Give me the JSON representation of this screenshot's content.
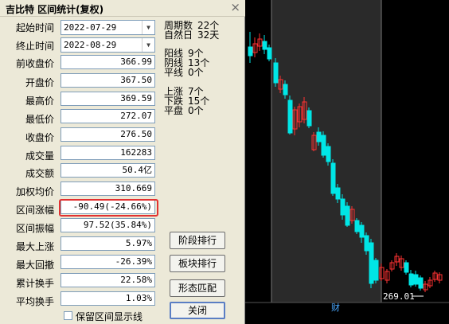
{
  "dialog": {
    "title": "吉比特 区间统计(复权)",
    "close_glyph": "×"
  },
  "start": {
    "label": "起始时间",
    "value": "2022-07-29"
  },
  "end": {
    "label": "终止时间",
    "value": "2022-08-29"
  },
  "fields": [
    {
      "key": "prev_close",
      "label": "前收盘价",
      "value": "366.99"
    },
    {
      "key": "open",
      "label": "开盘价",
      "value": "367.50"
    },
    {
      "key": "high",
      "label": "最高价",
      "value": "369.59"
    },
    {
      "key": "low",
      "label": "最低价",
      "value": "272.07"
    },
    {
      "key": "close",
      "label": "收盘价",
      "value": "276.50"
    },
    {
      "key": "volume",
      "label": "成交量",
      "value": "162283"
    },
    {
      "key": "turnover",
      "label": "成交额",
      "value": "50.4亿"
    },
    {
      "key": "vwap",
      "label": "加权均价",
      "value": "310.669"
    },
    {
      "key": "change",
      "label": "区间涨幅",
      "value": "-90.49(-24.66%)"
    },
    {
      "key": "amplitude",
      "label": "区间振幅",
      "value": "97.52(35.84%)"
    },
    {
      "key": "max_rise",
      "label": "最大上涨",
      "value": "5.97%"
    },
    {
      "key": "max_drawdown",
      "label": "最大回撤",
      "value": "-26.39%"
    },
    {
      "key": "cum_turnover",
      "label": "累计换手",
      "value": "22.58%"
    },
    {
      "key": "avg_turnover",
      "label": "平均换手",
      "value": "1.03%"
    }
  ],
  "stats": [
    {
      "label": "周期数",
      "value": "22个"
    },
    {
      "label": "自然日",
      "value": "32天"
    },
    {
      "label": "阳线",
      "value": "9个"
    },
    {
      "label": "阴线",
      "value": "13个"
    },
    {
      "label": "平线",
      "value": "0个"
    },
    {
      "label": "上涨",
      "value": "7个"
    },
    {
      "label": "下跌",
      "value": "15个"
    },
    {
      "label": "平盘",
      "value": "0个"
    }
  ],
  "buttons": {
    "stage_rank": "阶段排行",
    "sector_rank": "板块排行",
    "pattern_match": "形态匹配",
    "close": "关闭"
  },
  "checkbox": {
    "label": "保留区间显示线",
    "checked": false
  },
  "chart": {
    "price_label": "269.01",
    "finance_tag": "财",
    "colors": {
      "up": "#ff3232",
      "down": "#00e6e6",
      "highlight": "#2a2a2a"
    }
  }
}
